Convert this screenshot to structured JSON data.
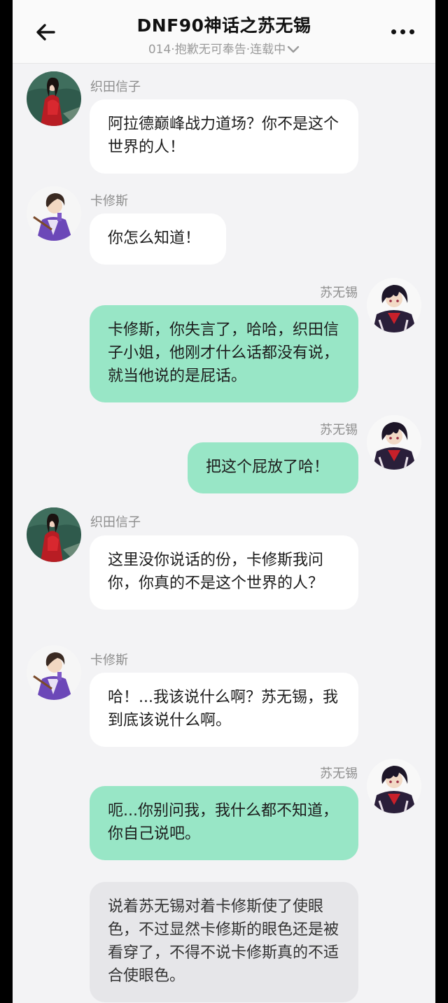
{
  "header": {
    "title": "DNF90神话之苏无锡",
    "subtitle": "014·抱歉无可奉告·连载中",
    "back_icon": "back-arrow-icon",
    "more_icon": "more-dots-icon",
    "chevron_icon": "chevron-down-icon"
  },
  "colors": {
    "background": "#f3f3f5",
    "bubble_self": "#98e6c6",
    "bubble_other": "#ffffff",
    "bubble_narration": "#e6e6e9"
  },
  "messages": [
    {
      "speaker": "织田信子",
      "text": "阿拉德巅峰战力道场？你不是这个世界的人！"
    },
    {
      "speaker": "卡修斯",
      "text": "你怎么知道！"
    },
    {
      "speaker": "苏无锡",
      "text": "卡修斯，你失言了，哈哈，织田信子小姐，他刚才什么话都没有说，就当他说的是屁话。"
    },
    {
      "speaker": "苏无锡",
      "text": "把这个屁放了哈！"
    },
    {
      "speaker": "织田信子",
      "text": "这里没你说话的份，卡修斯我问你，你真的不是这个世界的人？"
    },
    {
      "speaker": "卡修斯",
      "text": "哈！...我该说什么啊？苏无锡，我到底该说什么啊。"
    },
    {
      "speaker": "苏无锡",
      "text": "呃...你别问我，我什么都不知道，你自己说吧。"
    },
    {
      "speaker": "",
      "text": "说着苏无锡对着卡修斯使了使眼色，不过显然卡修斯的眼色还是被看穿了，不得不说卡修斯真的不适合使眼色。"
    }
  ]
}
